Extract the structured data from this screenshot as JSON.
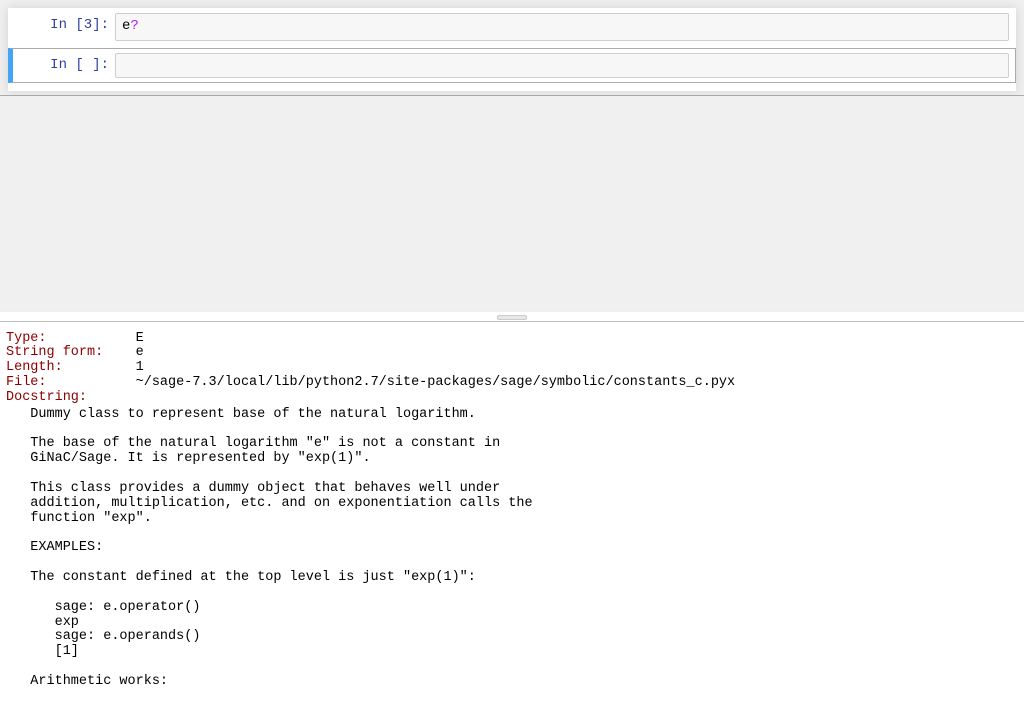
{
  "cells": [
    {
      "prompt_prefix": "In [",
      "prompt_num": "3",
      "prompt_suffix": "]:",
      "code_plain": "e",
      "code_op": "?",
      "selected": false
    },
    {
      "prompt_prefix": "In [",
      "prompt_num": " ",
      "prompt_suffix": "]:",
      "code_plain": "",
      "code_op": "",
      "selected": true
    }
  ],
  "doc": {
    "fields": [
      {
        "key": "Type:",
        "val": "E"
      },
      {
        "key": "String form:",
        "val": "e"
      },
      {
        "key": "Length:",
        "val": "1"
      },
      {
        "key": "File:",
        "val": "~/sage-7.3/local/lib/python2.7/site-packages/sage/symbolic/constants_c.pyx"
      },
      {
        "key": "Docstring:",
        "val": ""
      }
    ],
    "body": "   Dummy class to represent base of the natural logarithm.\n\n   The base of the natural logarithm \"e\" is not a constant in\n   GiNaC/Sage. It is represented by \"exp(1)\".\n\n   This class provides a dummy object that behaves well under\n   addition, multiplication, etc. and on exponentiation calls the\n   function \"exp\".\n\n   EXAMPLES:\n\n   The constant defined at the top level is just \"exp(1)\":\n\n      sage: e.operator()\n      exp\n      sage: e.operands()\n      [1]\n\n   Arithmetic works:"
  }
}
